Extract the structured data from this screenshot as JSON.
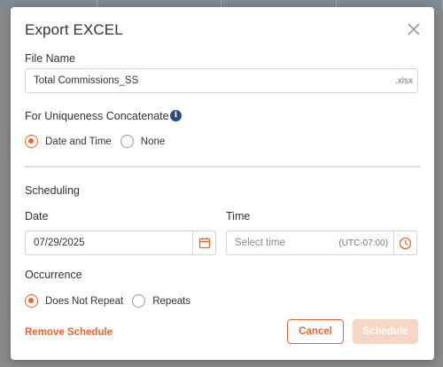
{
  "dialog": {
    "title": "Export EXCEL",
    "close_icon": "close-icon"
  },
  "file_name": {
    "label": "File Name",
    "value": "Total Commissions_SS",
    "suffix": ".xlsx"
  },
  "uniqueness": {
    "label": "For Uniqueness Concatenate",
    "info_icon": "info-icon",
    "options": [
      {
        "label": "Date and Time",
        "selected": true
      },
      {
        "label": "None",
        "selected": false
      }
    ]
  },
  "scheduling": {
    "heading": "Scheduling",
    "date": {
      "label": "Date",
      "value": "07/29/2025",
      "icon": "calendar-icon"
    },
    "time": {
      "label": "Time",
      "placeholder": "Select time",
      "timezone": "(UTC-07:00)",
      "icon": "clock-icon"
    },
    "occurrence": {
      "label": "Occurrence",
      "options": [
        {
          "label": "Does Not Repeat",
          "selected": true
        },
        {
          "label": "Repeats",
          "selected": false
        }
      ]
    }
  },
  "footer": {
    "remove_label": "Remove Schedule",
    "cancel_label": "Cancel",
    "schedule_label": "Schedule"
  },
  "colors": {
    "accent": "#e8652d",
    "accent_disabled": "#f7d6c6",
    "info": "#2c4a80"
  }
}
